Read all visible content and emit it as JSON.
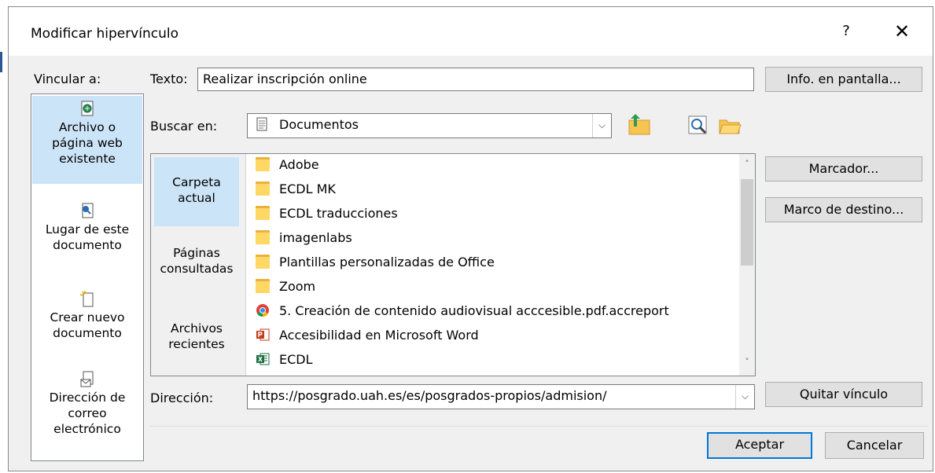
{
  "dialog": {
    "title": "Modificar hipervínculo",
    "help": "?",
    "close": "✕"
  },
  "link_to": {
    "label": "Vincular a:",
    "items": [
      {
        "l1": "Archivo o",
        "l2": "página web",
        "l3": "existente"
      },
      {
        "l1": "Lugar de este",
        "l2": "documento"
      },
      {
        "l1": "Crear nuevo",
        "l2": "documento"
      },
      {
        "l1": "Dirección de",
        "l2": "correo",
        "l3": "electrónico"
      }
    ]
  },
  "text": {
    "label": "Texto:",
    "value": "Realizar inscripción online"
  },
  "screentip_button": "Info. en pantalla...",
  "lookin": {
    "label": "Buscar en:",
    "value": "Documentos"
  },
  "places": [
    {
      "l1": "Carpeta",
      "l2": "actual"
    },
    {
      "l1": "Páginas",
      "l2": "consultadas"
    },
    {
      "l1": "Archivos",
      "l2": "recientes"
    }
  ],
  "files": [
    {
      "name": "Adobe",
      "icon": "folder-icon"
    },
    {
      "name": "ECDL MK",
      "icon": "folder-icon"
    },
    {
      "name": "ECDL traducciones",
      "icon": "folder-icon"
    },
    {
      "name": "imagenlabs",
      "icon": "folder-icon"
    },
    {
      "name": "Plantillas personalizadas de Office",
      "icon": "folder-icon"
    },
    {
      "name": "Zoom",
      "icon": "folder-icon"
    },
    {
      "name": "5. Creación de contenido audiovisual acccesible.pdf.accreport",
      "icon": "chrome-icon"
    },
    {
      "name": "Accesibilidad en Microsoft Word",
      "icon": "powerpoint-icon"
    },
    {
      "name": "ECDL",
      "icon": "excel-icon"
    }
  ],
  "bookmark_button": "Marcador...",
  "target_frame_button": "Marco de destino...",
  "address": {
    "label": "Dirección:",
    "value": "https://posgrado.uah.es/es/posgrados-propios/admision/"
  },
  "remove_link_button": "Quitar vínculo",
  "ok_button": "Aceptar",
  "cancel_button": "Cancelar",
  "colors": {
    "selection": "#cce4f7",
    "accent": "#0078d7",
    "folder": "#ffd764"
  }
}
